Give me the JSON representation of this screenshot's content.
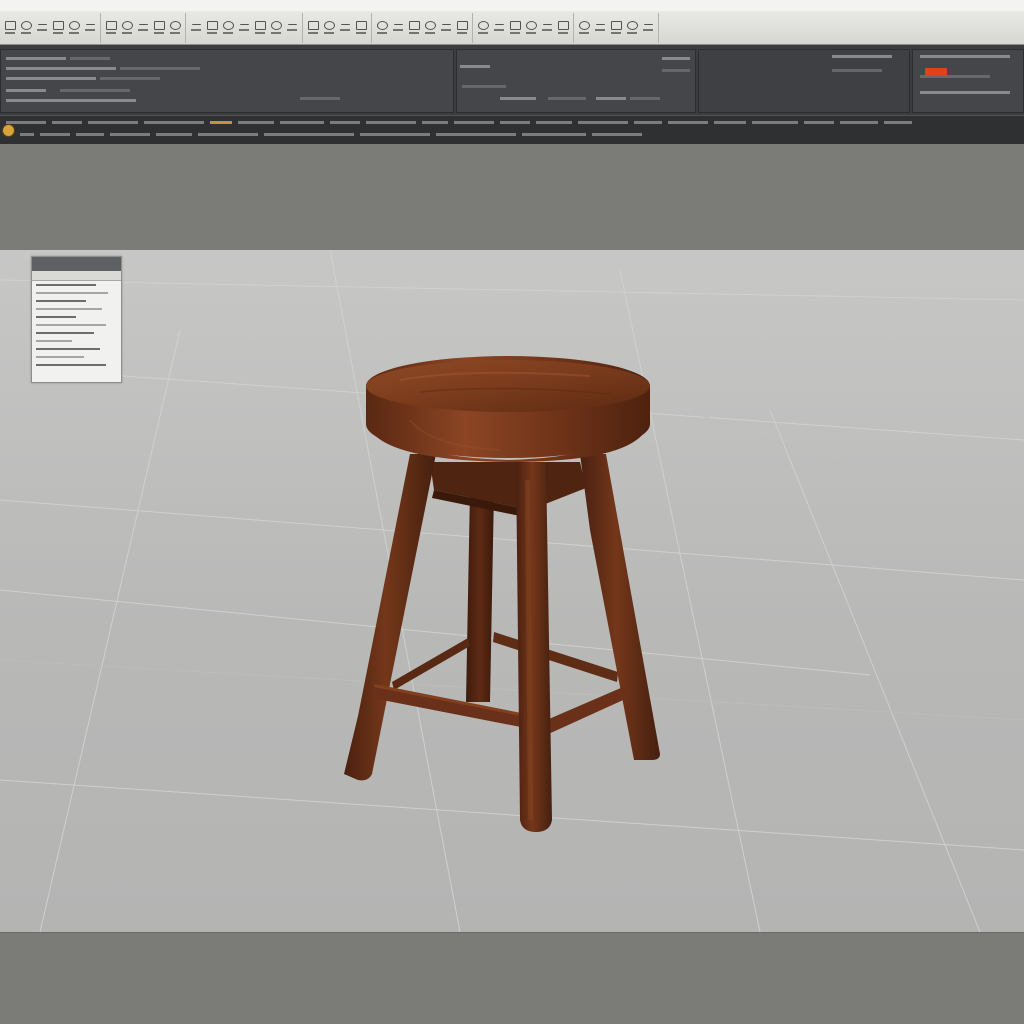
{
  "app": {
    "window_title": ""
  },
  "toolbar": {
    "groups": [
      {
        "icons": [
          "select-icon",
          "move-icon",
          "rotate-icon",
          "scale-icon",
          "snap-icon",
          "grid-icon"
        ]
      },
      {
        "icons": [
          "box-icon",
          "sphere-icon",
          "cylinder-icon",
          "plane-icon",
          "torus-icon"
        ]
      },
      {
        "icons": [
          "extrude-icon",
          "bevel-icon",
          "loop-cut-icon",
          "knife-icon",
          "bridge-icon",
          "merge-icon",
          "weld-icon"
        ]
      },
      {
        "icons": [
          "material-icon",
          "texture-icon",
          "uv-icon",
          "paint-icon"
        ]
      },
      {
        "icons": [
          "light-icon",
          "camera-icon",
          "render-icon",
          "preview-icon",
          "settings-icon",
          "layers-icon"
        ]
      },
      {
        "icons": [
          "align-icon",
          "mirror-icon",
          "array-icon",
          "group-icon",
          "hide-icon",
          "lock-icon"
        ]
      },
      {
        "icons": [
          "undo-icon",
          "redo-icon",
          "save-icon",
          "open-icon",
          "export-icon"
        ]
      }
    ]
  },
  "colors": {
    "accent_red": "#e1401a",
    "status_highlight": "#c7a545",
    "wood_dark": "#4a2413",
    "wood_mid": "#7a3b1c",
    "wood_light": "#9a5330",
    "viewport_bg": "#c1c1c0"
  },
  "viewport": {
    "object_name": "",
    "info_panel": {
      "title": "",
      "subtitle": ""
    }
  },
  "status": {
    "prompt_icon": "app-icon"
  }
}
